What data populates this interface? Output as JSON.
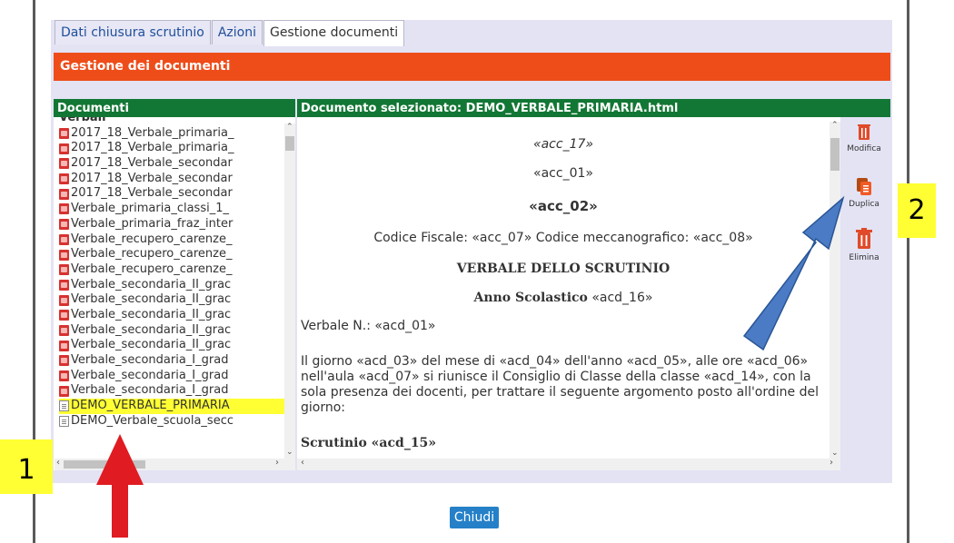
{
  "tabs": [
    {
      "label": "Dati chiusura scrutinio",
      "active": false
    },
    {
      "label": "Azioni",
      "active": false
    },
    {
      "label": "Gestione documenti",
      "active": true
    }
  ],
  "section_title": "Gestione dei documenti",
  "documents": {
    "header": "Documenti",
    "group_label": "Verbali",
    "items": [
      {
        "label": "2017_18_Verbale_primaria_",
        "icon": "pdf-icon"
      },
      {
        "label": "2017_18_Verbale_primaria_",
        "icon": "pdf-icon"
      },
      {
        "label": "2017_18_Verbale_secondar",
        "icon": "pdf-icon"
      },
      {
        "label": "2017_18_Verbale_secondar",
        "icon": "pdf-icon"
      },
      {
        "label": "2017_18_Verbale_secondar",
        "icon": "pdf-icon"
      },
      {
        "label": "Verbale_primaria_classi_1_",
        "icon": "pdf-icon"
      },
      {
        "label": "Verbale_primaria_fraz_inter",
        "icon": "pdf-icon"
      },
      {
        "label": "Verbale_recupero_carenze_",
        "icon": "pdf-icon"
      },
      {
        "label": "Verbale_recupero_carenze_",
        "icon": "pdf-icon"
      },
      {
        "label": "Verbale_recupero_carenze_",
        "icon": "pdf-icon"
      },
      {
        "label": "Verbale_secondaria_II_grac",
        "icon": "pdf-icon"
      },
      {
        "label": "Verbale_secondaria_II_grac",
        "icon": "pdf-icon"
      },
      {
        "label": "Verbale_secondaria_II_grac",
        "icon": "pdf-icon"
      },
      {
        "label": "Verbale_secondaria_II_grac",
        "icon": "pdf-icon"
      },
      {
        "label": "Verbale_secondaria_II_grac",
        "icon": "pdf-icon"
      },
      {
        "label": "Verbale_secondaria_I_grad",
        "icon": "pdf-icon"
      },
      {
        "label": "Verbale_secondaria_I_grad",
        "icon": "pdf-icon"
      },
      {
        "label": "Verbale_secondaria_I_grad",
        "icon": "pdf-icon"
      },
      {
        "label": "DEMO_VERBALE_PRIMARIA",
        "icon": "document-icon",
        "selected": true
      },
      {
        "label": "DEMO_Verbale_scuola_secc",
        "icon": "document-icon"
      }
    ]
  },
  "selected_document": {
    "header": "Documento selezionato: DEMO_VERBALE_PRIMARIA.html",
    "line_acc17": "«acc_17»",
    "line_acc01": "«acc_01»",
    "line_acc02": "«acc_02»",
    "line_codici": "Codice Fiscale: «acc_07» Codice meccanografico: «acc_08»",
    "line_title": "VERBALE DELLO SCRUTINIO",
    "line_anno_label": "Anno Scolastico",
    "line_anno_value": "«acd_16»",
    "line_verbale": "Verbale N.: «acd_01»",
    "paragraph": "Il giorno «acd_03» del mese di «acd_04» dell'anno «acd_05», alle ore «acd_06» nell'aula «acd_07» si riunisce il Consiglio di Classe della classe «acd_14», con la sola presenza dei docenti, per trattare il seguente argomento posto all'ordine del giorno:",
    "line_scrutinio": "Scrutinio «acd_15»"
  },
  "actions": {
    "modifica": "Modifica",
    "duplica": "Duplica",
    "elimina": "Elimina"
  },
  "close_label": "Chiudi",
  "annotations": {
    "badge1": "1",
    "badge2": "2"
  },
  "colors": {
    "section_bar": "#ee4d1a",
    "header_bar": "#127734",
    "highlight": "#ffff33",
    "arrow_red": "#e01b22",
    "arrow_blue": "#4a7bc4",
    "button_blue": "#2580c8"
  }
}
